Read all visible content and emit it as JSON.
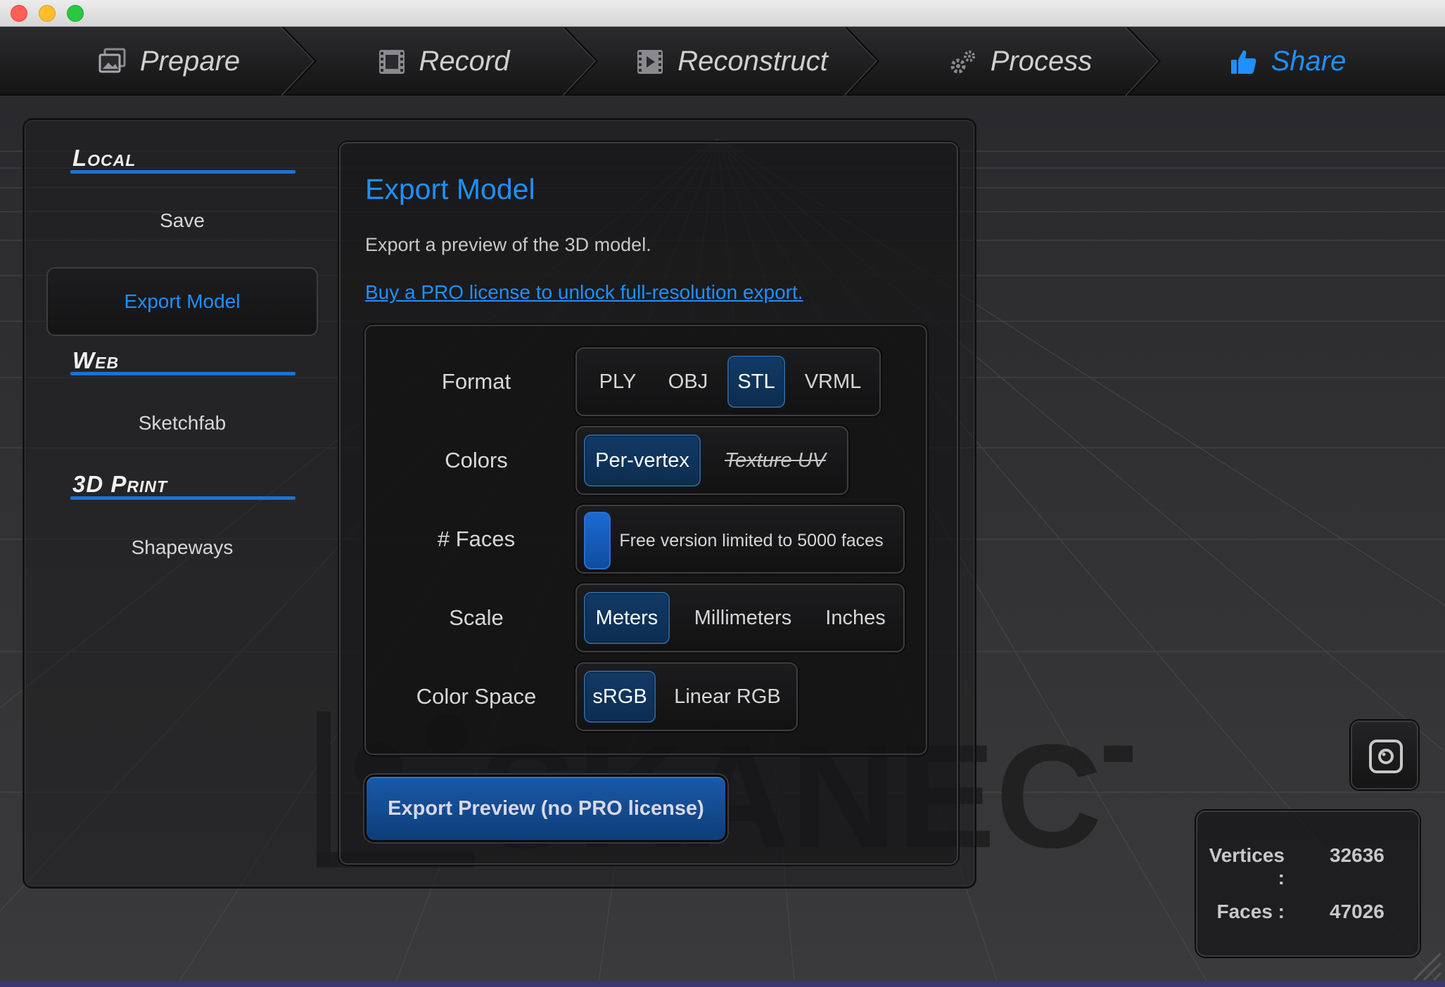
{
  "tabs": [
    {
      "label": "Prepare",
      "icon": "photos-icon",
      "active": false
    },
    {
      "label": "Record",
      "icon": "film-icon",
      "active": false
    },
    {
      "label": "Reconstruct",
      "icon": "film-strip-icon",
      "active": false
    },
    {
      "label": "Process",
      "icon": "gears-icon",
      "active": false
    },
    {
      "label": "Share",
      "icon": "thumbs-up-icon",
      "active": true
    }
  ],
  "sidebar": {
    "sections": [
      {
        "title": "Local",
        "items": [
          "Save",
          "Export Model"
        ]
      },
      {
        "title": "Web",
        "items": [
          "Sketchfab"
        ]
      },
      {
        "title": "3D Print",
        "items": [
          "Shapeways"
        ]
      }
    ],
    "selected": "Export Model"
  },
  "content": {
    "title": "Export Model",
    "description": "Export a preview of the 3D model.",
    "link": "Buy a PRO license to unlock full-resolution export."
  },
  "options": {
    "format": {
      "label": "Format",
      "choices": [
        "PLY",
        "OBJ",
        "STL",
        "VRML"
      ],
      "selected": "STL"
    },
    "colors": {
      "label": "Colors",
      "choices": [
        "Per-vertex",
        "Texture UV"
      ],
      "selected": "Per-vertex",
      "disabled": [
        "Texture UV"
      ]
    },
    "faces": {
      "label": "# Faces",
      "value_text": "Free version limited to 5000 faces"
    },
    "scale": {
      "label": "Scale",
      "choices": [
        "Meters",
        "Millimeters",
        "Inches"
      ],
      "selected": "Meters"
    },
    "color_space": {
      "label": "Color Space",
      "choices": [
        "sRGB",
        "Linear RGB"
      ],
      "selected": "sRGB"
    }
  },
  "export_button": "Export Preview (no PRO license)",
  "snapshot_icon": "camera-snapshot-icon",
  "stats": {
    "vertices_label": "Vertices :",
    "vertices": "32636",
    "faces_label": "Faces :",
    "faces": "47026"
  },
  "watermark": "SKANECT",
  "colors": {
    "accent": "#1e90ff",
    "selected_bg": "#0c2d50"
  }
}
